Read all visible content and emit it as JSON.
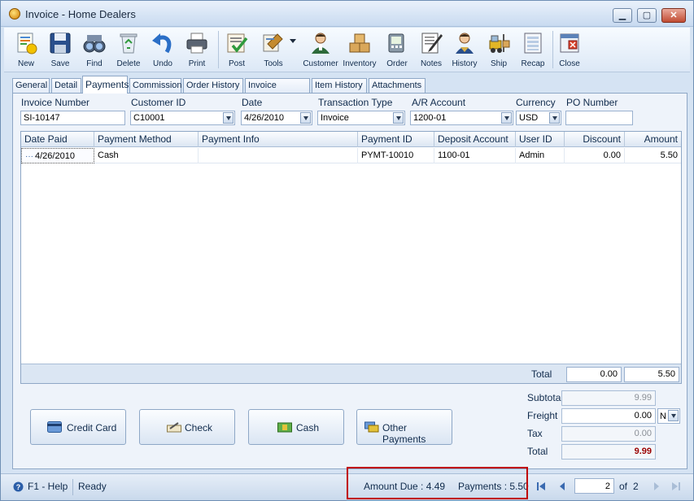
{
  "window": {
    "title": "Invoice - Home Dealers"
  },
  "toolbar": {
    "items": [
      {
        "label": "New",
        "icon": "new-document-icon"
      },
      {
        "label": "Save",
        "icon": "floppy-disk-icon"
      },
      {
        "label": "Find",
        "icon": "binoculars-icon"
      },
      {
        "label": "Delete",
        "icon": "recycle-bin-icon"
      },
      {
        "label": "Undo",
        "icon": "undo-arrow-icon"
      },
      {
        "label": "Print",
        "icon": "printer-icon"
      },
      {
        "label": "Post",
        "icon": "post-check-icon"
      },
      {
        "label": "Tools",
        "icon": "tools-icon"
      },
      {
        "label": "Customer",
        "icon": "customer-person-icon"
      },
      {
        "label": "Inventory",
        "icon": "boxes-icon"
      },
      {
        "label": "Order",
        "icon": "order-icon"
      },
      {
        "label": "Notes",
        "icon": "notes-pen-icon"
      },
      {
        "label": "History",
        "icon": "history-person-icon"
      },
      {
        "label": "Ship",
        "icon": "forklift-icon"
      },
      {
        "label": "Recap",
        "icon": "recap-icon"
      },
      {
        "label": "Close",
        "icon": "close-window-icon"
      }
    ]
  },
  "tabs": [
    "General",
    "Detail",
    "Payments",
    "Commission",
    "Order History",
    "Invoice History",
    "Item History",
    "Attachments"
  ],
  "active_tab": "Payments",
  "form": {
    "invoice_number_label": "Invoice Number",
    "invoice_number": "SI-10147",
    "customer_id_label": "Customer ID",
    "customer_id": "C10001",
    "date_label": "Date",
    "date": "4/26/2010",
    "transaction_type_label": "Transaction Type",
    "transaction_type": "Invoice",
    "ar_account_label": "A/R Account",
    "ar_account": "1200-01",
    "currency_label": "Currency",
    "currency": "USD",
    "po_number_label": "PO Number",
    "po_number": ""
  },
  "grid": {
    "columns": [
      "Date Paid",
      "Payment Method",
      "Payment Info",
      "Payment ID",
      "Deposit Account",
      "User ID",
      "Discount",
      "Amount"
    ],
    "rows": [
      {
        "date_paid": "4/26/2010",
        "payment_method": "Cash",
        "payment_info": "",
        "payment_id": "PYMT-10010",
        "deposit_account": "1100-01",
        "user_id": "Admin",
        "discount": "0.00",
        "amount": "5.50"
      }
    ],
    "footer": {
      "label": "Total",
      "discount_total": "0.00",
      "amount_total": "5.50"
    }
  },
  "payment_buttons": [
    {
      "label": "Credit Card",
      "icon": "credit-card-icon"
    },
    {
      "label": "Check",
      "icon": "check-icon"
    },
    {
      "label": "Cash",
      "icon": "cash-icon"
    },
    {
      "label": "Other Payments",
      "icon": "other-payments-icon"
    }
  ],
  "totals": {
    "subtotal_label": "Subtotal",
    "subtotal": "9.99",
    "freight_label": "Freight",
    "freight": "0.00",
    "freight_option": "N",
    "tax_label": "Tax",
    "tax": "0.00",
    "total_label": "Total",
    "total": "9.99"
  },
  "status": {
    "help": "F1 - Help",
    "state": "Ready",
    "amount_due": "Amount Due : 4.49",
    "payments": "Payments : 5.50",
    "page": "2",
    "of_label": "of",
    "page_count": "2"
  },
  "colors": {
    "highlight_border": "#c00000",
    "total_value": "#9a0000",
    "window_bg": "#d5e3f3"
  }
}
